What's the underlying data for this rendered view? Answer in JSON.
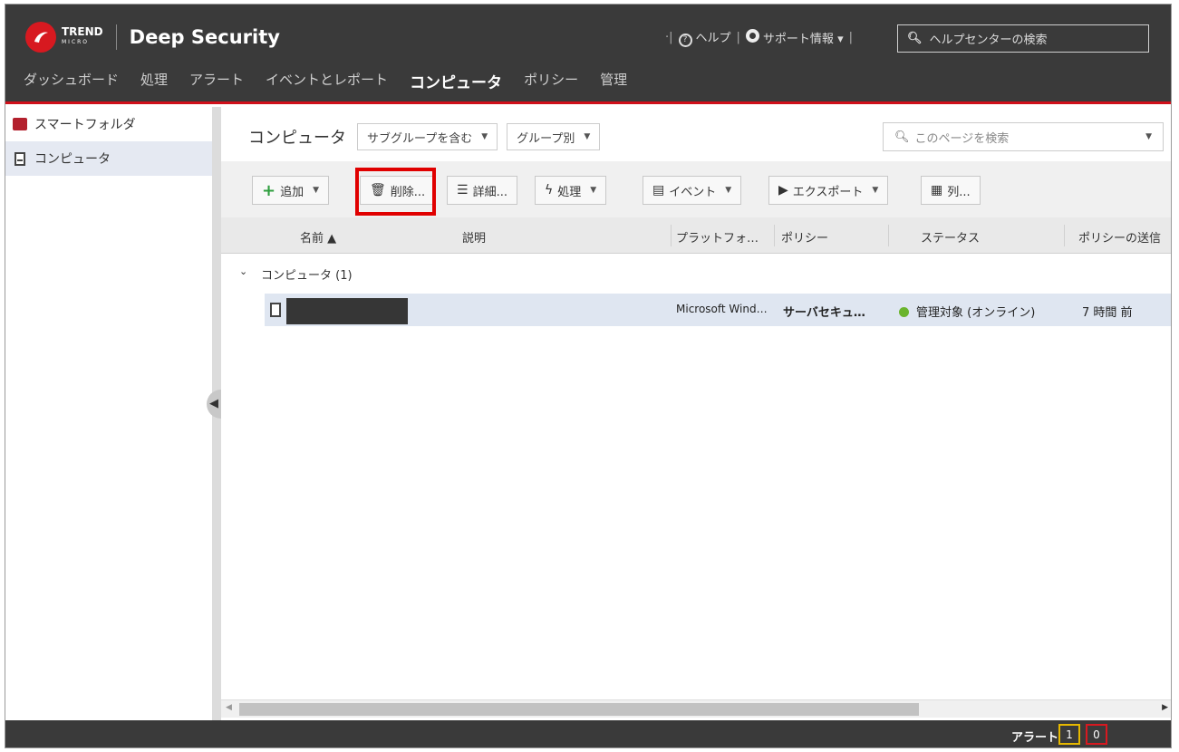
{
  "app": {
    "brand_top": "TREND",
    "brand_sub": "MICRO",
    "product": "Deep Security"
  },
  "header": {
    "help": "ヘルプ",
    "support": "サポート情報",
    "help_search_placeholder": "ヘルプセンターの検索"
  },
  "nav": [
    {
      "label": "ダッシュボード"
    },
    {
      "label": "処理"
    },
    {
      "label": "アラート"
    },
    {
      "label": "イベントとレポート"
    },
    {
      "label": "コンピュータ"
    },
    {
      "label": "ポリシー"
    },
    {
      "label": "管理"
    }
  ],
  "sidebar": {
    "items": [
      {
        "label": "スマートフォルダ"
      },
      {
        "label": "コンピュータ"
      }
    ]
  },
  "main": {
    "title": "コンピュータ",
    "filter1": "サブグループを含む",
    "filter2": "グループ別",
    "page_search_placeholder": "このページを検索"
  },
  "toolbar": {
    "add": "追加",
    "delete": "削除...",
    "details": "詳細...",
    "actions": "処理",
    "events": "イベント",
    "export": "エクスポート",
    "columns": "列..."
  },
  "table": {
    "columns": [
      "名前 ▲",
      "説明",
      "プラットフォ…",
      "ポリシー",
      "ステータス",
      "ポリシーの送信"
    ],
    "group_label": "コンピュータ (1)",
    "rows": [
      {
        "platform": "Microsoft Wind…",
        "policy": "サーバセキュ…",
        "status": "管理対象 (オンライン)",
        "policy_sent": "7 時間 前"
      }
    ]
  },
  "footer": {
    "alerts_label": "アラート",
    "warning_count": "1",
    "critical_count": "0"
  },
  "colors": {
    "header_bg": "#3a3a3a",
    "accent_red": "#d0101a",
    "selected_row": "#dfe6f1",
    "online_green": "#6ab42d",
    "highlight_box": "#e00000"
  }
}
